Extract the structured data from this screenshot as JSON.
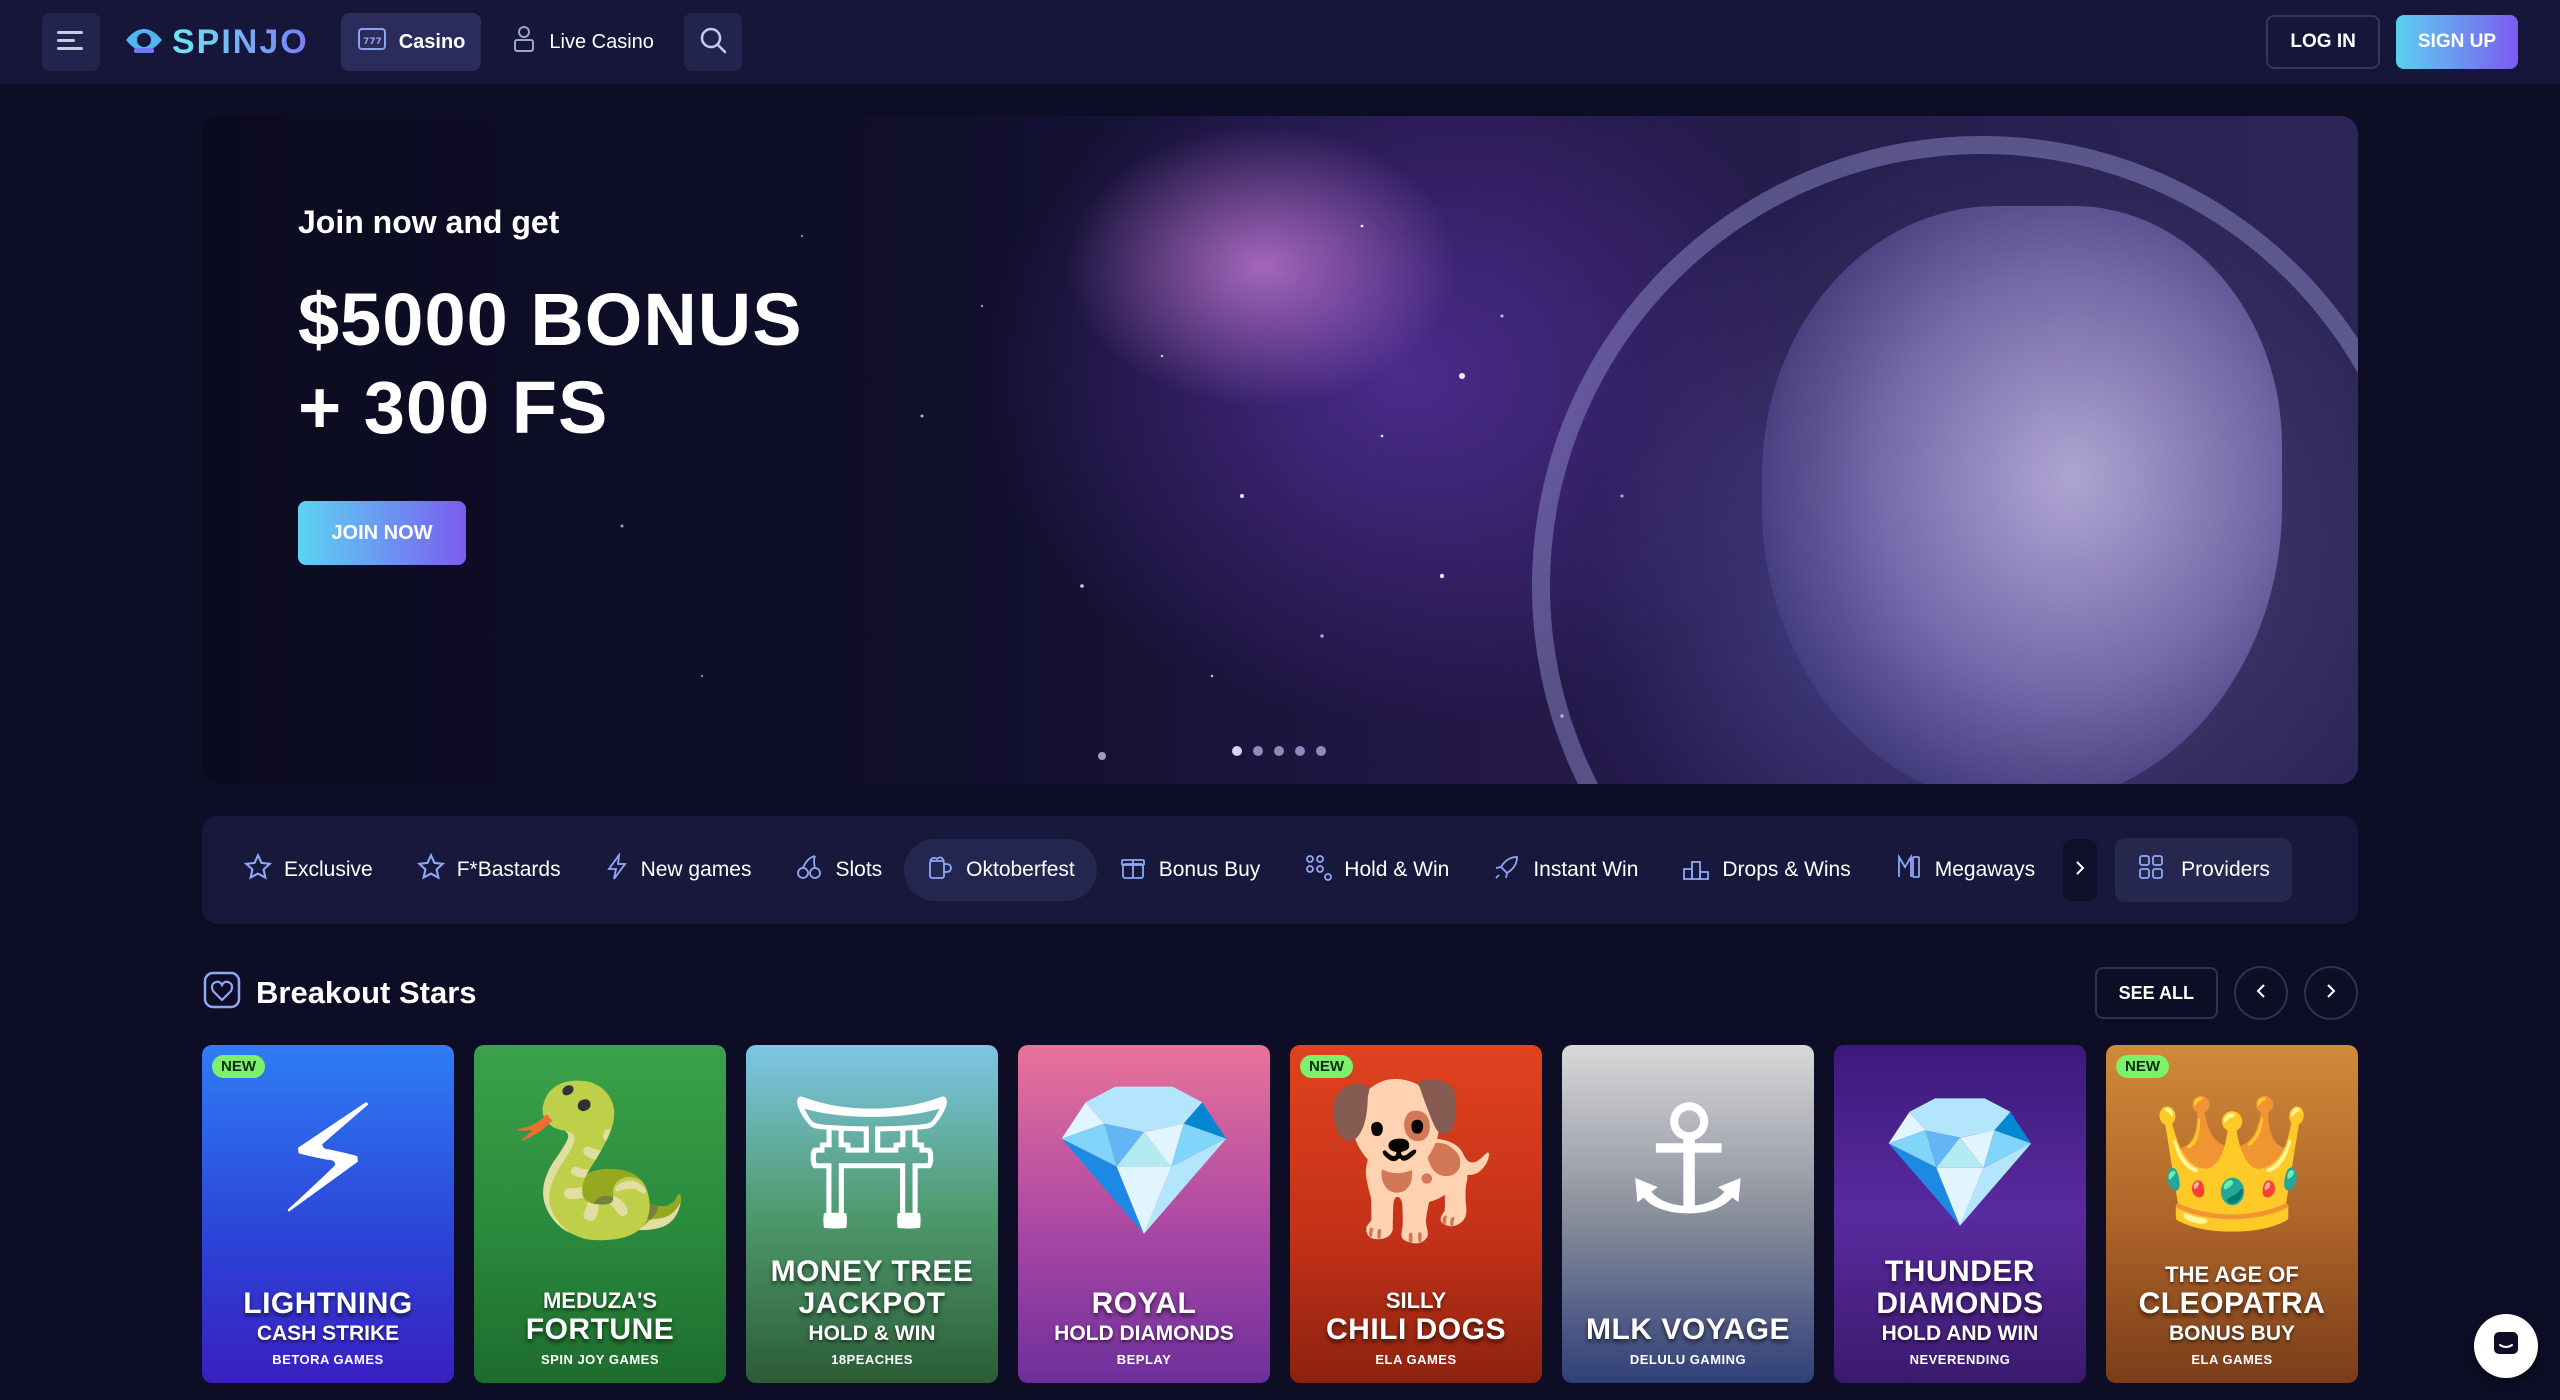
{
  "header": {
    "brand": "SPINJO",
    "nav": [
      {
        "label": "Casino",
        "icon": "slot-machine-icon",
        "active": true
      },
      {
        "label": "Live Casino",
        "icon": "dealer-icon",
        "active": false
      }
    ],
    "login_label": "LOG IN",
    "signup_label": "SIGN UP"
  },
  "hero": {
    "subtitle": "Join now and get",
    "title_line1": "$5000 BONUS",
    "title_line2": "+ 300 FS",
    "cta_label": "JOIN NOW",
    "slides": 5,
    "active_slide": 1
  },
  "categories": {
    "items": [
      {
        "label": "Exclusive",
        "icon": "star-icon"
      },
      {
        "label": "F*Bastards",
        "icon": "star-outline-icon"
      },
      {
        "label": "New games",
        "icon": "lightning-icon"
      },
      {
        "label": "Slots",
        "icon": "cherry-icon"
      },
      {
        "label": "Oktoberfest",
        "icon": "beer-mug-icon",
        "active": true
      },
      {
        "label": "Bonus Buy",
        "icon": "gift-icon"
      },
      {
        "label": "Hold & Win",
        "icon": "grid-dots-icon"
      },
      {
        "label": "Instant Win",
        "icon": "rocket-icon"
      },
      {
        "label": "Drops & Wins",
        "icon": "podium-icon"
      },
      {
        "label": "Megaways",
        "icon": "megaways-icon"
      }
    ],
    "providers_label": "Providers"
  },
  "section": {
    "title": "Breakout Stars",
    "see_all_label": "SEE ALL"
  },
  "games": [
    {
      "pre": "",
      "title": "LIGHTNING",
      "sub": "CASH STRIKE",
      "provider": "BETORA GAMES",
      "badge": "NEW",
      "art": "⚡",
      "bg": "linear-gradient(180deg,#2f7df5 0%,#2b46d8 55%,#3a1ec2 100%)"
    },
    {
      "pre": "MEDUZA'S",
      "title": "FORTUNE",
      "sub": "",
      "provider": "SPIN JOY GAMES",
      "badge": "",
      "art": "🐍",
      "bg": "linear-gradient(180deg,#3aa24a 0%,#2a8a3c 55%,#1e6c2d 100%)"
    },
    {
      "pre": "",
      "title": "MONEY TREE JACKPOT",
      "sub": "HOLD & WIN",
      "provider": "18PEACHES",
      "badge": "",
      "art": "⛩",
      "bg": "linear-gradient(180deg,#7ec6e6 0%,#4f9a6c 50%,#2b5c36 100%)"
    },
    {
      "pre": "",
      "title": "ROYAL",
      "sub": "HOLD DIAMONDS",
      "provider": "BEPLAY",
      "badge": "",
      "art": "💎",
      "bg": "linear-gradient(180deg,#e8739a 0%,#b04aa4 50%,#6d2f9c 100%)"
    },
    {
      "pre": "SILLY",
      "title": "CHILI DOGS",
      "sub": "",
      "provider": "ELA GAMES",
      "badge": "NEW",
      "art": "🐕",
      "bg": "linear-gradient(180deg,#e0421f 0%,#c53218 55%,#8c220f 100%)"
    },
    {
      "pre": "",
      "title": "MLK VOYAGE",
      "sub": "",
      "provider": "DELULU GAMING",
      "badge": "",
      "art": "⚓",
      "bg": "linear-gradient(180deg,#d8d8d8 0%,#8a8f9c 50%,#2f3f78 100%)"
    },
    {
      "pre": "",
      "title": "THUNDER DIAMONDS",
      "sub": "HOLD AND WIN",
      "provider": "NEVERENDING",
      "badge": "",
      "art": "💎",
      "bg": "linear-gradient(180deg,#3b1a7a 0%,#5a2aa0 50%,#3a1a6c 100%)"
    },
    {
      "pre": "THE AGE OF",
      "title": "CLEOPATRA",
      "sub": "BONUS BUY",
      "provider": "ELA GAMES",
      "badge": "NEW",
      "art": "👑",
      "bg": "linear-gradient(180deg,#d08a3a 0%,#b0652a 50%,#7a3d1a 100%)"
    }
  ]
}
